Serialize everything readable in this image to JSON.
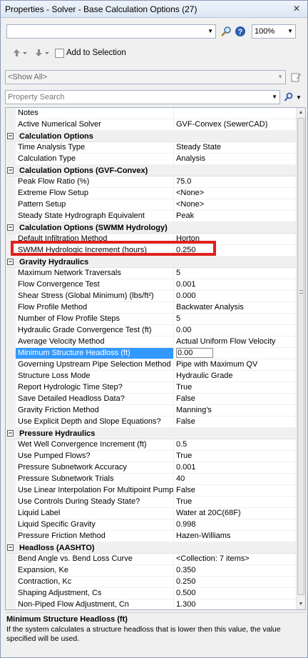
{
  "window": {
    "title": "Properties - Solver - Base Calculation Options (27)",
    "close_glyph": "✕"
  },
  "toolbar": {
    "element_selector_value": "",
    "zoom_value": "100%",
    "add_to_selection_label": "Add to Selection"
  },
  "filter": {
    "value": "<Show All>"
  },
  "search": {
    "placeholder": "Property Search"
  },
  "rows": [
    {
      "type": "prop",
      "name": "Notes",
      "value": ""
    },
    {
      "type": "prop",
      "name": "Active Numerical Solver",
      "value": "GVF-Convex (SewerCAD)"
    },
    {
      "type": "cat",
      "name": "Calculation Options"
    },
    {
      "type": "prop",
      "name": "Time Analysis Type",
      "value": "Steady State"
    },
    {
      "type": "prop",
      "name": "Calculation Type",
      "value": "Analysis"
    },
    {
      "type": "cat",
      "name": "Calculation Options (GVF-Convex)"
    },
    {
      "type": "prop",
      "name": "Peak Flow Ratio (%)",
      "value": "75.0"
    },
    {
      "type": "prop",
      "name": "Extreme Flow Setup",
      "value": "<None>"
    },
    {
      "type": "prop",
      "name": "Pattern Setup",
      "value": "<None>"
    },
    {
      "type": "prop",
      "name": "Steady State Hydrograph Equivalent",
      "value": "Peak"
    },
    {
      "type": "cat",
      "name": "Calculation Options (SWMM Hydrology)"
    },
    {
      "type": "prop",
      "name": "Default Infiltration Method",
      "value": "Horton"
    },
    {
      "type": "prop",
      "name": "SWMM Hydrologic Increment (hours)",
      "value": "0.250"
    },
    {
      "type": "cat",
      "name": "Gravity Hydraulics"
    },
    {
      "type": "prop",
      "name": "Maximum Network Traversals",
      "value": "5"
    },
    {
      "type": "prop",
      "name": "Flow Convergence Test",
      "value": "0.001"
    },
    {
      "type": "prop",
      "name": "Shear Stress (Global Minimum) (lbs/ft²)",
      "value": "0.000"
    },
    {
      "type": "prop",
      "name": "Flow Profile Method",
      "value": "Backwater Analysis"
    },
    {
      "type": "prop",
      "name": "Number of Flow Profile Steps",
      "value": "5"
    },
    {
      "type": "prop",
      "name": "Hydraulic Grade Convergence Test (ft)",
      "value": "0.00"
    },
    {
      "type": "prop",
      "name": "Average Velocity Method",
      "value": "Actual Uniform Flow Velocity"
    },
    {
      "type": "prop",
      "name": "Minimum Structure Headloss (ft)",
      "value": "0.00",
      "selected": true
    },
    {
      "type": "prop",
      "name": "Governing Upstream Pipe Selection Method",
      "value": "Pipe with Maximum QV"
    },
    {
      "type": "prop",
      "name": "Structure Loss Mode",
      "value": "Hydraulic Grade"
    },
    {
      "type": "prop",
      "name": "Report Hydrologic Time Step?",
      "value": "True"
    },
    {
      "type": "prop",
      "name": "Save Detailed Headloss Data?",
      "value": "False"
    },
    {
      "type": "prop",
      "name": "Gravity Friction Method",
      "value": "Manning's"
    },
    {
      "type": "prop",
      "name": "Use Explicit Depth and Slope Equations?",
      "value": "False"
    },
    {
      "type": "cat",
      "name": "Pressure Hydraulics"
    },
    {
      "type": "prop",
      "name": "Wet Well Convergence Increment (ft)",
      "value": "0.5"
    },
    {
      "type": "prop",
      "name": "Use Pumped Flows?",
      "value": "True"
    },
    {
      "type": "prop",
      "name": "Pressure Subnetwork Accuracy",
      "value": "0.001"
    },
    {
      "type": "prop",
      "name": "Pressure Subnetwork Trials",
      "value": "40"
    },
    {
      "type": "prop",
      "name": "Use Linear Interpolation For Multipoint Pump",
      "value": "False"
    },
    {
      "type": "prop",
      "name": "Use Controls During Steady State?",
      "value": "True"
    },
    {
      "type": "prop",
      "name": "Liquid Label",
      "value": "Water at 20C(68F)"
    },
    {
      "type": "prop",
      "name": "Liquid Specific Gravity",
      "value": "0.998"
    },
    {
      "type": "prop",
      "name": "Pressure Friction Method",
      "value": "Hazen-Williams"
    },
    {
      "type": "cat",
      "name": "Headloss (AASHTO)"
    },
    {
      "type": "prop",
      "name": "Bend Angle vs. Bend Loss Curve",
      "value": "<Collection: 7 items>"
    },
    {
      "type": "prop",
      "name": "Expansion, Ke",
      "value": "0.350"
    },
    {
      "type": "prop",
      "name": "Contraction, Kc",
      "value": "0.250"
    },
    {
      "type": "prop",
      "name": "Shaping Adjustment, Cs",
      "value": "0.500"
    },
    {
      "type": "prop",
      "name": "Non-Piped Flow Adjustment, Cn",
      "value": "1.300"
    }
  ],
  "description": {
    "title": "Minimum Structure Headloss (ft)",
    "text": "If the system calculates a structure headloss that is lower then this value, the value specified will be used."
  },
  "colors": {
    "selection": "#3399ff",
    "highlight_box": "#e0211f",
    "panel_bg": "#f0f0f0"
  },
  "icons": [
    "close-icon",
    "find-icon",
    "help-icon",
    "navigate-back-icon",
    "navigate-forward-icon",
    "filter-properties-icon",
    "search-icon",
    "collapse-icon",
    "scroll-up-icon",
    "scroll-down-icon"
  ]
}
